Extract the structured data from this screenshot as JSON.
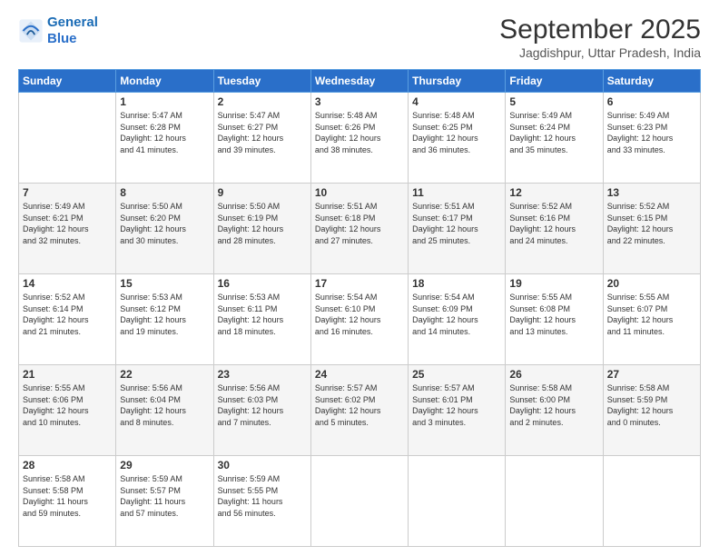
{
  "header": {
    "logo_line1": "General",
    "logo_line2": "Blue",
    "month_title": "September 2025",
    "location": "Jagdishpur, Uttar Pradesh, India"
  },
  "days_of_week": [
    "Sunday",
    "Monday",
    "Tuesday",
    "Wednesday",
    "Thursday",
    "Friday",
    "Saturday"
  ],
  "weeks": [
    [
      {
        "day": "",
        "info": ""
      },
      {
        "day": "1",
        "info": "Sunrise: 5:47 AM\nSunset: 6:28 PM\nDaylight: 12 hours\nand 41 minutes."
      },
      {
        "day": "2",
        "info": "Sunrise: 5:47 AM\nSunset: 6:27 PM\nDaylight: 12 hours\nand 39 minutes."
      },
      {
        "day": "3",
        "info": "Sunrise: 5:48 AM\nSunset: 6:26 PM\nDaylight: 12 hours\nand 38 minutes."
      },
      {
        "day": "4",
        "info": "Sunrise: 5:48 AM\nSunset: 6:25 PM\nDaylight: 12 hours\nand 36 minutes."
      },
      {
        "day": "5",
        "info": "Sunrise: 5:49 AM\nSunset: 6:24 PM\nDaylight: 12 hours\nand 35 minutes."
      },
      {
        "day": "6",
        "info": "Sunrise: 5:49 AM\nSunset: 6:23 PM\nDaylight: 12 hours\nand 33 minutes."
      }
    ],
    [
      {
        "day": "7",
        "info": "Sunrise: 5:49 AM\nSunset: 6:21 PM\nDaylight: 12 hours\nand 32 minutes."
      },
      {
        "day": "8",
        "info": "Sunrise: 5:50 AM\nSunset: 6:20 PM\nDaylight: 12 hours\nand 30 minutes."
      },
      {
        "day": "9",
        "info": "Sunrise: 5:50 AM\nSunset: 6:19 PM\nDaylight: 12 hours\nand 28 minutes."
      },
      {
        "day": "10",
        "info": "Sunrise: 5:51 AM\nSunset: 6:18 PM\nDaylight: 12 hours\nand 27 minutes."
      },
      {
        "day": "11",
        "info": "Sunrise: 5:51 AM\nSunset: 6:17 PM\nDaylight: 12 hours\nand 25 minutes."
      },
      {
        "day": "12",
        "info": "Sunrise: 5:52 AM\nSunset: 6:16 PM\nDaylight: 12 hours\nand 24 minutes."
      },
      {
        "day": "13",
        "info": "Sunrise: 5:52 AM\nSunset: 6:15 PM\nDaylight: 12 hours\nand 22 minutes."
      }
    ],
    [
      {
        "day": "14",
        "info": "Sunrise: 5:52 AM\nSunset: 6:14 PM\nDaylight: 12 hours\nand 21 minutes."
      },
      {
        "day": "15",
        "info": "Sunrise: 5:53 AM\nSunset: 6:12 PM\nDaylight: 12 hours\nand 19 minutes."
      },
      {
        "day": "16",
        "info": "Sunrise: 5:53 AM\nSunset: 6:11 PM\nDaylight: 12 hours\nand 18 minutes."
      },
      {
        "day": "17",
        "info": "Sunrise: 5:54 AM\nSunset: 6:10 PM\nDaylight: 12 hours\nand 16 minutes."
      },
      {
        "day": "18",
        "info": "Sunrise: 5:54 AM\nSunset: 6:09 PM\nDaylight: 12 hours\nand 14 minutes."
      },
      {
        "day": "19",
        "info": "Sunrise: 5:55 AM\nSunset: 6:08 PM\nDaylight: 12 hours\nand 13 minutes."
      },
      {
        "day": "20",
        "info": "Sunrise: 5:55 AM\nSunset: 6:07 PM\nDaylight: 12 hours\nand 11 minutes."
      }
    ],
    [
      {
        "day": "21",
        "info": "Sunrise: 5:55 AM\nSunset: 6:06 PM\nDaylight: 12 hours\nand 10 minutes."
      },
      {
        "day": "22",
        "info": "Sunrise: 5:56 AM\nSunset: 6:04 PM\nDaylight: 12 hours\nand 8 minutes."
      },
      {
        "day": "23",
        "info": "Sunrise: 5:56 AM\nSunset: 6:03 PM\nDaylight: 12 hours\nand 7 minutes."
      },
      {
        "day": "24",
        "info": "Sunrise: 5:57 AM\nSunset: 6:02 PM\nDaylight: 12 hours\nand 5 minutes."
      },
      {
        "day": "25",
        "info": "Sunrise: 5:57 AM\nSunset: 6:01 PM\nDaylight: 12 hours\nand 3 minutes."
      },
      {
        "day": "26",
        "info": "Sunrise: 5:58 AM\nSunset: 6:00 PM\nDaylight: 12 hours\nand 2 minutes."
      },
      {
        "day": "27",
        "info": "Sunrise: 5:58 AM\nSunset: 5:59 PM\nDaylight: 12 hours\nand 0 minutes."
      }
    ],
    [
      {
        "day": "28",
        "info": "Sunrise: 5:58 AM\nSunset: 5:58 PM\nDaylight: 11 hours\nand 59 minutes."
      },
      {
        "day": "29",
        "info": "Sunrise: 5:59 AM\nSunset: 5:57 PM\nDaylight: 11 hours\nand 57 minutes."
      },
      {
        "day": "30",
        "info": "Sunrise: 5:59 AM\nSunset: 5:55 PM\nDaylight: 11 hours\nand 56 minutes."
      },
      {
        "day": "",
        "info": ""
      },
      {
        "day": "",
        "info": ""
      },
      {
        "day": "",
        "info": ""
      },
      {
        "day": "",
        "info": ""
      }
    ]
  ]
}
